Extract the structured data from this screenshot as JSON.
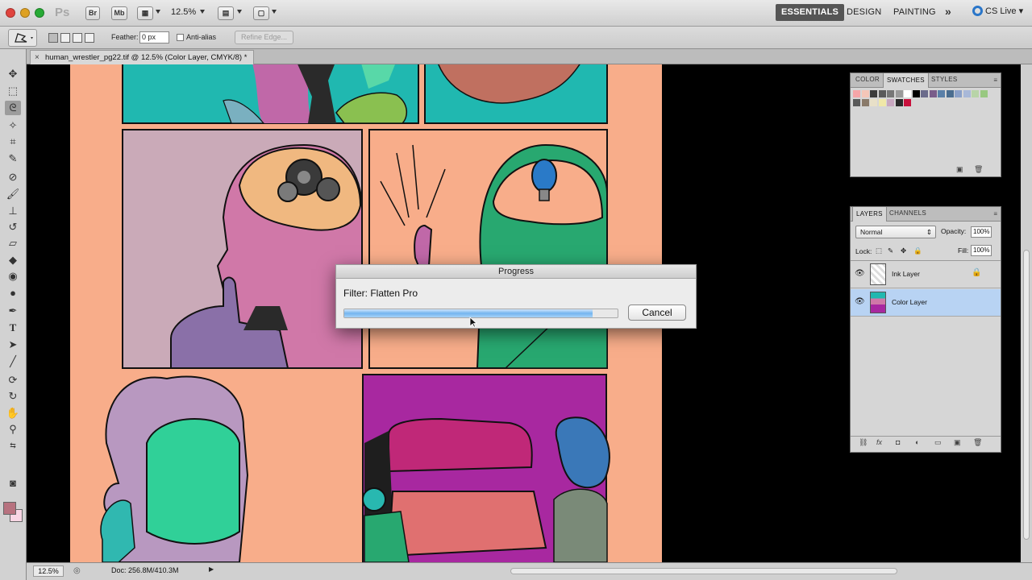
{
  "app": {
    "logo": "Ps",
    "buttons": [
      "Br",
      "Mb"
    ],
    "zoom": "12.5%",
    "workspaces": [
      "ESSENTIALS",
      "DESIGN",
      "PAINTING"
    ],
    "more": "»",
    "cs_live": "CS Live"
  },
  "options": {
    "feather_label": "Feather:",
    "feather_value": "0 px",
    "antialias_label": "Anti-alias",
    "refine_label": "Refine Edge..."
  },
  "document": {
    "tab_title": "human_wrestler_pg22.tif @ 12.5% (Color Layer, CMYK/8) *",
    "tab_close": "×"
  },
  "swatches_panel": {
    "tabs": [
      "COLOR",
      "SWATCHES",
      "STYLES"
    ],
    "active_tab": "SWATCHES",
    "menu": "≡",
    "colors": [
      "#f6a5a8",
      "#f4c6b8",
      "#3c3c3c",
      "#5a5a5a",
      "#777777",
      "#9a9a9a",
      "#ffffff",
      "#000000",
      "#6b6b8b",
      "#7a5d8a",
      "#5a80a8",
      "#4a6d8f",
      "#8aa0c8",
      "#a8b8d8",
      "#b8d4a8",
      "#98c880",
      "#5a5a5a",
      "#8a7a6a",
      "#e8e0c8",
      "#f0e8a8",
      "#c8a8c0",
      "#2a2a2a",
      "#c8103c"
    ]
  },
  "layers_panel": {
    "tabs": [
      "LAYERS",
      "CHANNELS"
    ],
    "active_tab": "LAYERS",
    "menu": "≡",
    "blend_mode": "Normal",
    "opacity_label": "Opacity:",
    "opacity_value": "100%",
    "lock_label": "Lock:",
    "fill_label": "Fill:",
    "fill_value": "100%",
    "layers": [
      {
        "name": "Ink Layer",
        "selected": false,
        "locked": true
      },
      {
        "name": "Color Layer",
        "selected": true,
        "locked": false
      }
    ],
    "footer_icons": [
      "link-icon",
      "fx-icon",
      "mask-icon",
      "adjustment-icon",
      "group-icon",
      "new-layer-icon",
      "trash-icon"
    ]
  },
  "status": {
    "zoom": "12.5%",
    "doc": "Doc: 256.8M/410.3M"
  },
  "progress_dialog": {
    "title": "Progress",
    "filter": "Filter: Flatten Pro",
    "progress": 0.91,
    "cancel": "Cancel"
  },
  "colors": {
    "page": "#f8ad8a",
    "selection": "#b8d3f3",
    "progress": "#74b5ef",
    "foreground": "#b7727f",
    "background": "#f8d6e4"
  }
}
